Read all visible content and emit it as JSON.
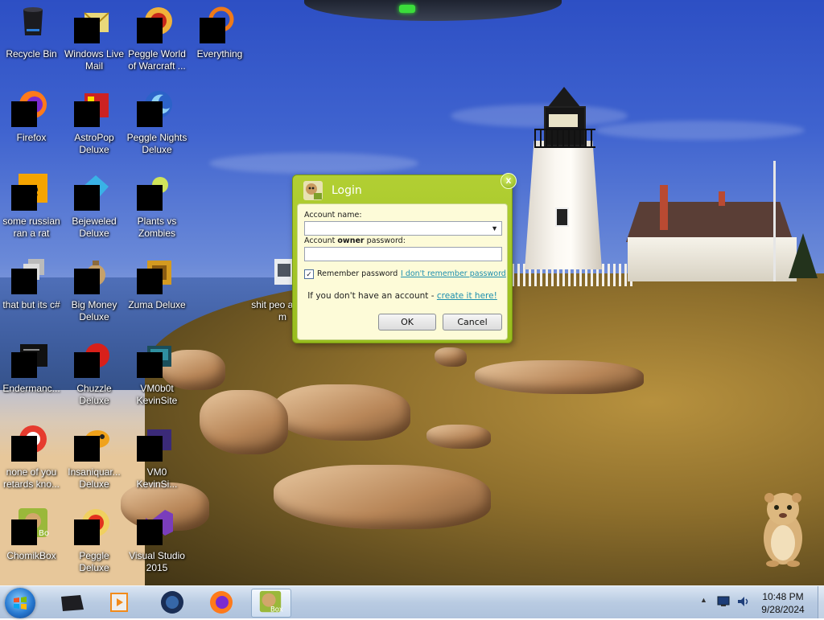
{
  "desktop": {
    "icons": [
      {
        "label": "Recycle Bin"
      },
      {
        "label": "Windows Live Mail"
      },
      {
        "label": "Peggle World of Warcraft ..."
      },
      {
        "label": "Everything"
      },
      {
        "label": "Firefox"
      },
      {
        "label": "AstroPop Deluxe"
      },
      {
        "label": "Peggle Nights Deluxe"
      },
      {
        "label": "some russian ran a rat"
      },
      {
        "label": "Bejeweled Deluxe"
      },
      {
        "label": "Plants vs Zombies"
      },
      {
        "label": "that but its c#"
      },
      {
        "label": "Big Money Deluxe"
      },
      {
        "label": "Zuma Deluxe"
      },
      {
        "label": "shit peo asked m"
      },
      {
        "label": "Endermanc..."
      },
      {
        "label": "Chuzzle Deluxe"
      },
      {
        "label": "VM0b0t KevinSite"
      },
      {
        "label": "none of you retards kno..."
      },
      {
        "label": "Insaniquar... Deluxe"
      },
      {
        "label": "VM0 KevinSi..."
      },
      {
        "label": "ChomikBox"
      },
      {
        "label": "Peggle Deluxe"
      },
      {
        "label": "Visual Studio 2015"
      }
    ]
  },
  "login_dialog": {
    "title": "Login",
    "close_glyph": "x",
    "account_name_label": "Account name:",
    "account_name_value": "",
    "password_label_prefix": "Account ",
    "password_label_bold": "owner",
    "password_label_suffix": " password:",
    "password_value": "",
    "remember_label": "Remember password",
    "remember_checked": true,
    "forgot_link": "I don't remember password",
    "no_account_text": "If you don't have an account - ",
    "create_link": "create it here!",
    "ok_label": "OK",
    "cancel_label": "Cancel",
    "accent_color": "#a6c82a"
  },
  "taskbar": {
    "pinned": [
      "explorer-drive-icon",
      "media-player-icon",
      "globe-icon",
      "firefox-icon",
      "chomikbox-icon"
    ],
    "active_item": "chomikbox-icon",
    "tray_chevron": "▲",
    "time": "10:48 PM",
    "date": "9/28/2024"
  }
}
